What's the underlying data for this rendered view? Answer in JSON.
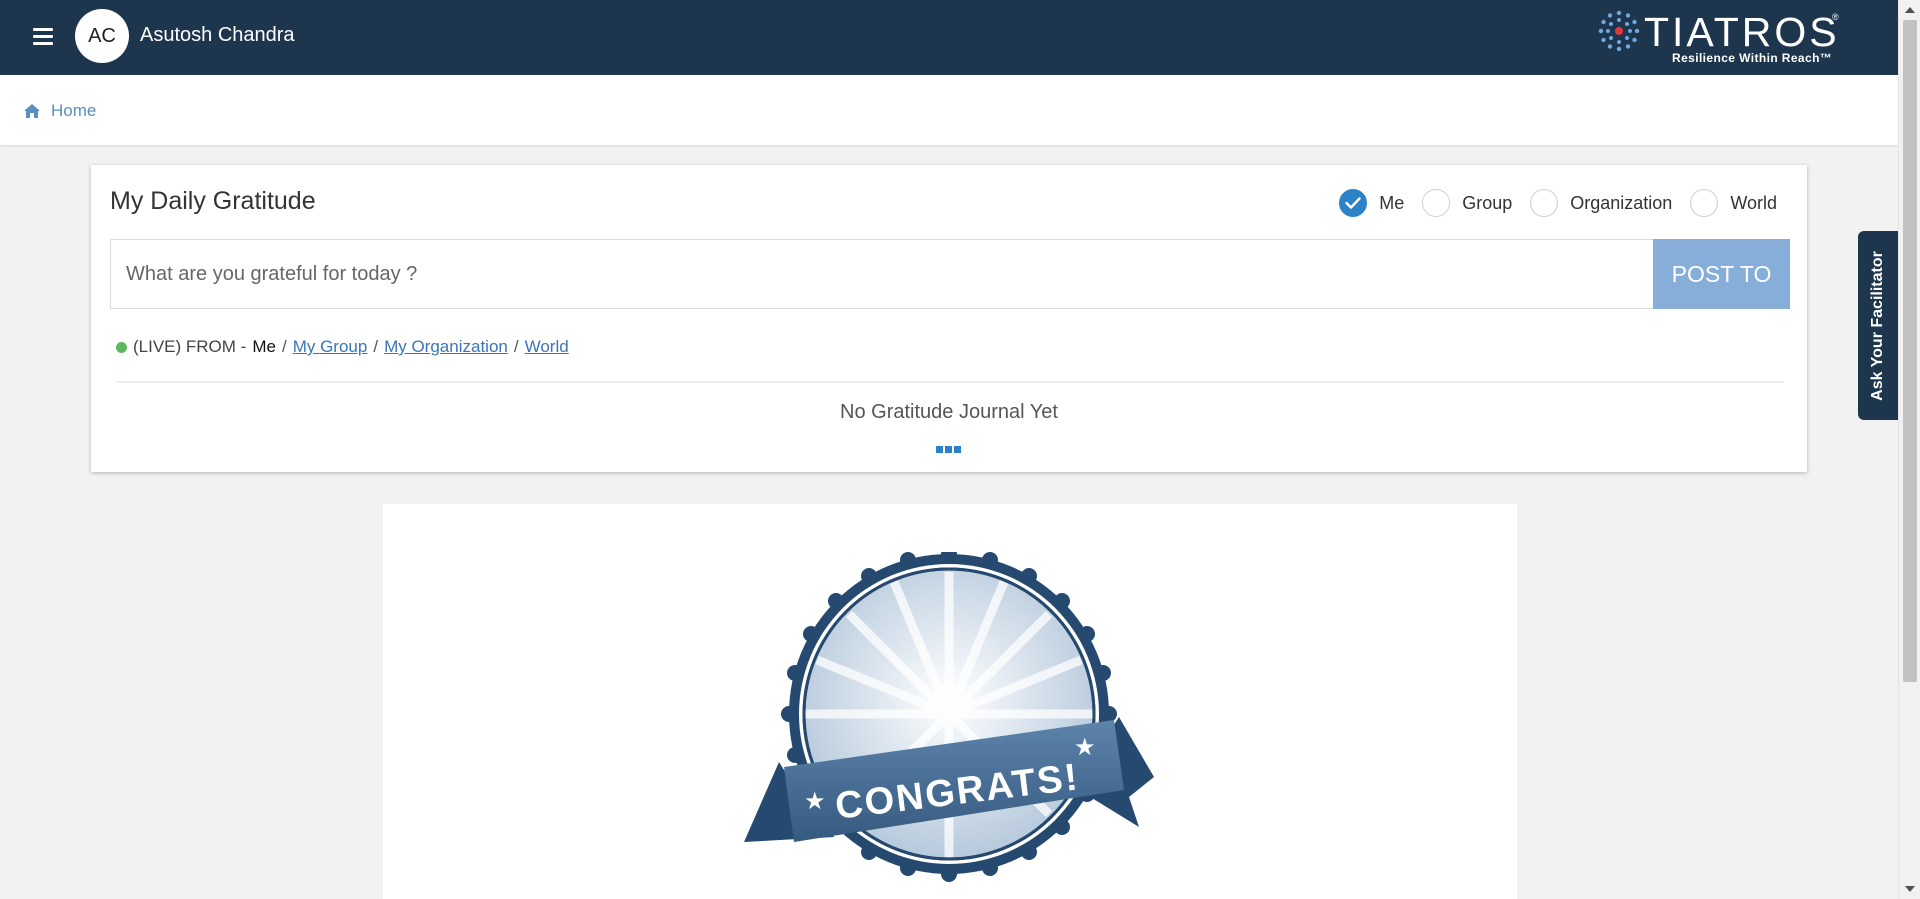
{
  "header": {
    "avatar_initials": "AC",
    "user_name": "Asutosh Chandra",
    "logo": {
      "word": "TIATROS",
      "registered_mark": "®",
      "tagline": "Resilience Within Reach™"
    },
    "menu_icon": "hamburger-icon"
  },
  "breadcrumb": {
    "icon": "home-icon",
    "label": "Home"
  },
  "gratitude": {
    "title": "My Daily Gratitude",
    "audience_options": [
      {
        "label": "Me",
        "checked": true
      },
      {
        "label": "Group",
        "checked": false
      },
      {
        "label": "Organization",
        "checked": false
      },
      {
        "label": "World",
        "checked": false
      }
    ],
    "input_placeholder": "What are you grateful for today ?",
    "post_button": "POST TO",
    "feed_prefix": "(LIVE) FROM -",
    "feed_me": "Me",
    "feed_separator": "/",
    "feed_links": [
      "My Group",
      "My Organization",
      "World"
    ],
    "empty_message": "No Gratitude Journal Yet"
  },
  "congrats": {
    "badge_text": "CONGRATS!",
    "star": "★"
  },
  "side_tab": {
    "label": "Ask Your Facilitator"
  },
  "colors": {
    "header_bg": "#1d364d",
    "accent": "#2a82c9",
    "post_button_bg": "#86aed8",
    "link": "#3a76b7",
    "live_dot": "#5cb85c"
  }
}
